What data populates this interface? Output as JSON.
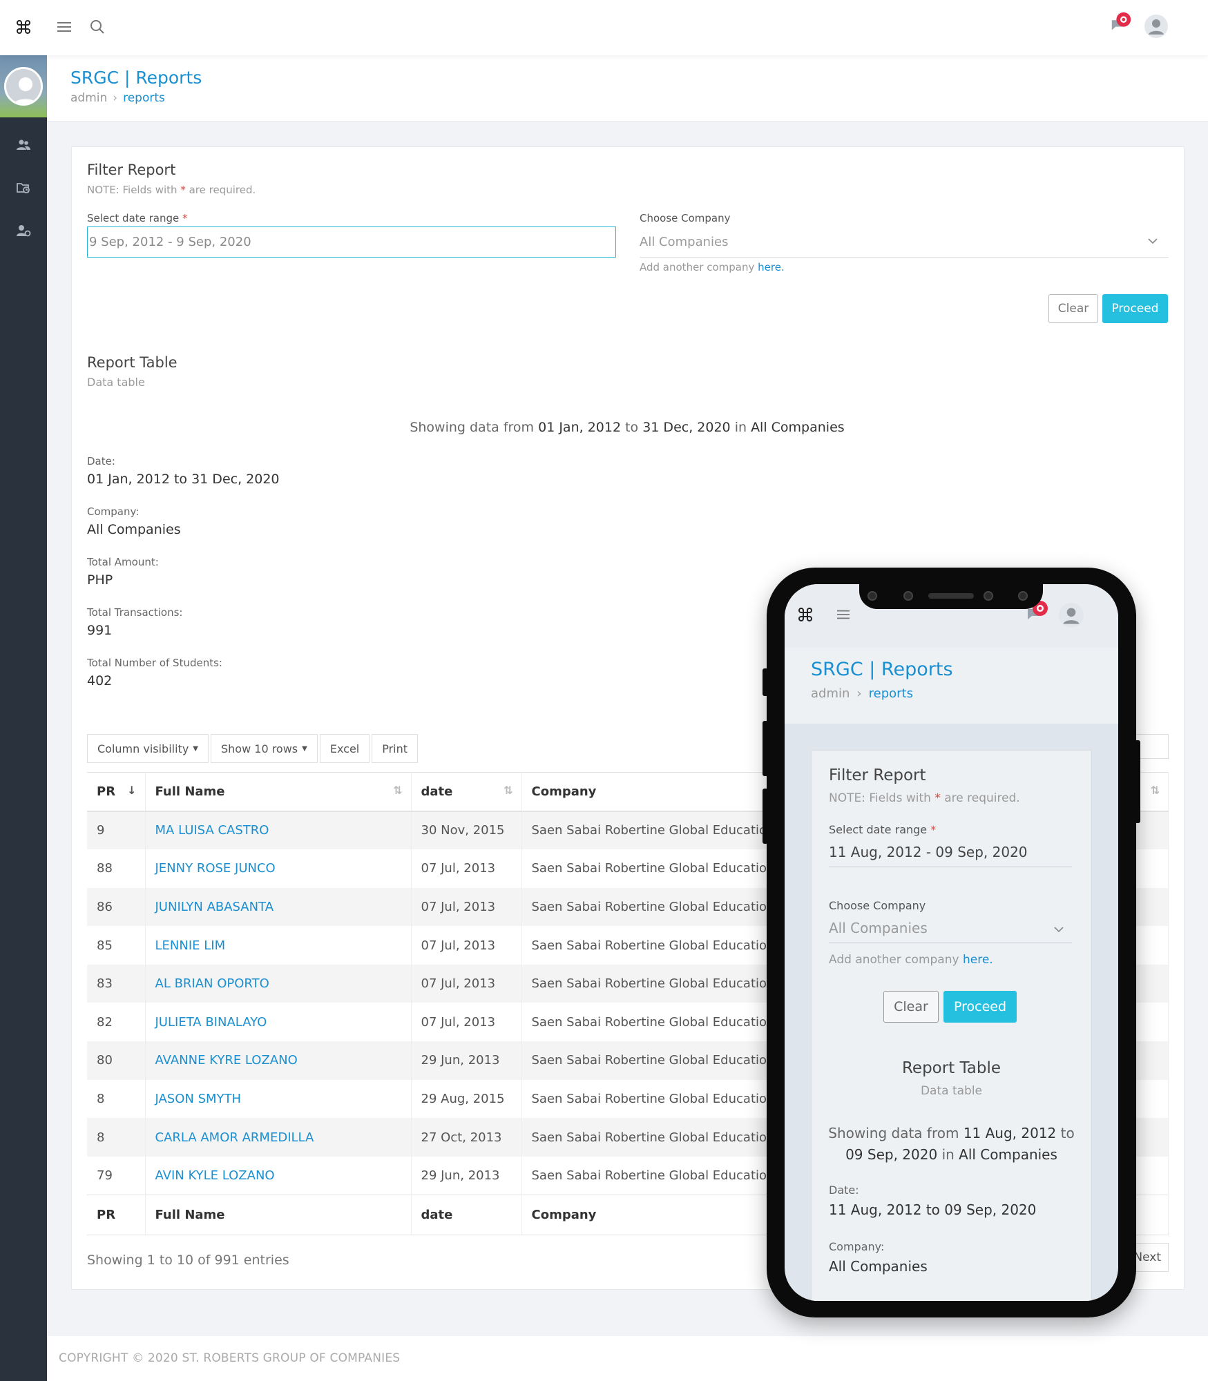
{
  "app": {
    "title": "SRGC | Reports",
    "breadcrumb": [
      "admin",
      "reports"
    ]
  },
  "icons": {
    "brand": "command-icon",
    "menu": "hamburger-menu-icon",
    "search": "search-icon",
    "notification": "chat-notification-icon",
    "profile": "user-avatar-icon",
    "sidebar": [
      "users-icon",
      "folder-clock-icon",
      "user-settings-icon"
    ]
  },
  "colors": {
    "accent": "#1a8fd1",
    "primary_button": "#25c0e0",
    "sidebar": "#2a323d",
    "required": "#e2453c"
  },
  "filter": {
    "title": "Filter Report",
    "note_prefix": "NOTE: Fields with",
    "note_required": "*",
    "note_suffix": "are required.",
    "date_label": "Select date range",
    "date_value": "9 Sep, 2012 - 9 Sep, 2020",
    "company_label": "Choose Company",
    "company_value": "All Companies",
    "add_company_prefix": "Add another company",
    "add_company_link": "here.",
    "clear": "Clear",
    "proceed": "Proceed"
  },
  "report": {
    "title": "Report Table",
    "subtitle": "Data table",
    "showing_prefix": "Showing data from",
    "from": "01 Jan, 2012",
    "to_word": "to",
    "to": "31 Dec, 2020",
    "in_word": "in",
    "scope": "All Companies",
    "stats": [
      {
        "label": "Date:",
        "value": "01 Jan, 2012 to 31 Dec, 2020"
      },
      {
        "label": "Company:",
        "value": "All Companies"
      },
      {
        "label": "Total Amount:",
        "value": "PHP"
      },
      {
        "label": "Total Transactions:",
        "value": "991"
      },
      {
        "label": "Total Number of Students:",
        "value": "402"
      }
    ]
  },
  "table_tools": {
    "column_visibility": "Column visibility",
    "show_rows": "Show 10 rows",
    "excel": "Excel",
    "print": "Print"
  },
  "table": {
    "columns": [
      "PR",
      "Full Name",
      "date",
      "Company"
    ],
    "rows": [
      {
        "pr": "9",
        "name": "MA LUISA CASTRO",
        "date": "30 Nov, 2015",
        "company": "Saen Sabai Robertine Global Educatio"
      },
      {
        "pr": "88",
        "name": "JENNY ROSE JUNCO",
        "date": "07 Jul, 2013",
        "company": "Saen Sabai Robertine Global Educatio"
      },
      {
        "pr": "86",
        "name": "JUNILYN ABASANTA",
        "date": "07 Jul, 2013",
        "company": "Saen Sabai Robertine Global Educatio"
      },
      {
        "pr": "85",
        "name": "LENNIE LIM",
        "date": "07 Jul, 2013",
        "company": "Saen Sabai Robertine Global Educatio"
      },
      {
        "pr": "83",
        "name": "AL BRIAN OPORTO",
        "date": "07 Jul, 2013",
        "company": "Saen Sabai Robertine Global Educatio"
      },
      {
        "pr": "82",
        "name": "JULIETA BINALAYO",
        "date": "07 Jul, 2013",
        "company": "Saen Sabai Robertine Global Educatio"
      },
      {
        "pr": "80",
        "name": "AVANNE KYRE LOZANO",
        "date": "29 Jun, 2013",
        "company": "Saen Sabai Robertine Global Educatio"
      },
      {
        "pr": "8",
        "name": "JASON SMYTH",
        "date": "29 Aug, 2015",
        "company": "Saen Sabai Robertine Global Educatio"
      },
      {
        "pr": "8",
        "name": "CARLA AMOR ARMEDILLA",
        "date": "27 Oct, 2013",
        "company": "Saen Sabai Robertine Global Educatio"
      },
      {
        "pr": "79",
        "name": "AVIN KYLE LOZANO",
        "date": "29 Jun, 2013",
        "company": "Saen Sabai Robertine Global Educatio"
      }
    ],
    "showing": "Showing 1 to 10 of 991 entries",
    "next": "Next"
  },
  "footer": "COPYRIGHT © 2020 ST. ROBERTS GROUP OF COMPANIES",
  "phone": {
    "title": "SRGC | Reports",
    "breadcrumb": [
      "admin",
      "reports"
    ],
    "filter_title": "Filter Report",
    "note_prefix": "NOTE: Fields with",
    "note_required": "*",
    "note_suffix": "are required.",
    "date_label": "Select date range",
    "date_value": "11 Aug, 2012 - 09 Sep, 2020",
    "company_label": "Choose Company",
    "company_value": "All Companies",
    "add_company_prefix": "Add another company",
    "add_company_link": "here.",
    "clear": "Clear",
    "proceed": "Proceed",
    "report_title": "Report Table",
    "report_subtitle": "Data table",
    "showing_prefix": "Showing data from",
    "from": "11 Aug, 2012",
    "to_word": "to",
    "to": "09 Sep, 2020",
    "in_word": "in",
    "scope": "All Companies",
    "date_stat_label": "Date:",
    "date_stat_value": "11 Aug, 2012 to 09 Sep, 2020",
    "company_stat_label": "Company:",
    "company_stat_value": "All Companies"
  }
}
